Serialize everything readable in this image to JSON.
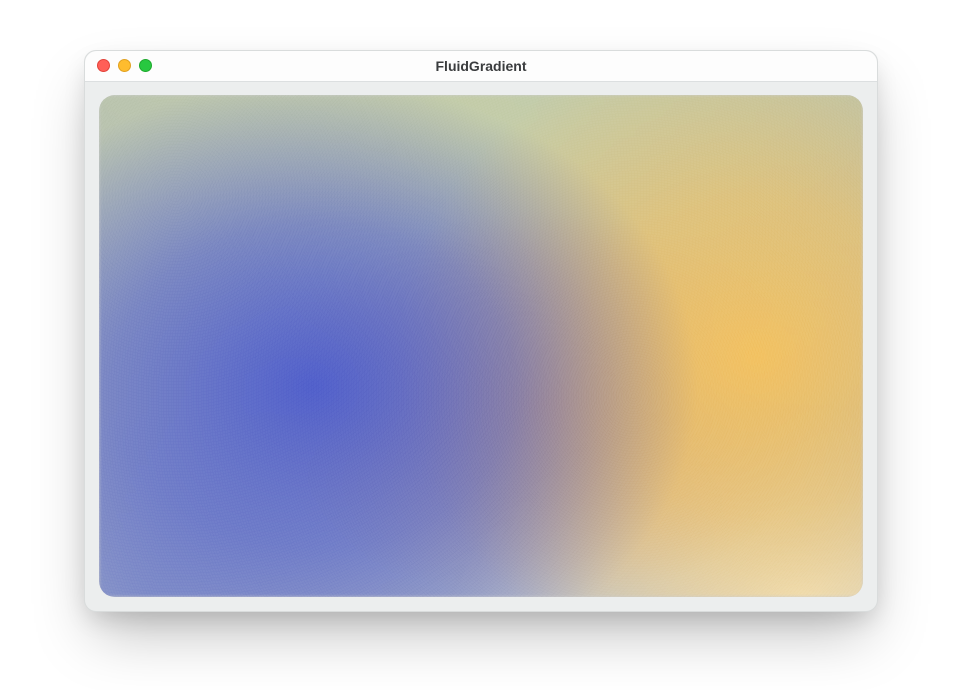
{
  "window": {
    "title": "FluidGradient"
  },
  "traffic_lights": {
    "close_name": "close",
    "minimize_name": "minimize",
    "zoom_name": "zoom"
  },
  "gradient": {
    "kind": "fluid-radial-blend",
    "description": "Soft multi-blob gradient: cool blue lower-left, warm yellow-orange right side, muted olive upper band",
    "corner_radius_px": 16,
    "blobs": [
      {
        "role": "cool",
        "center_pct": [
          28,
          58
        ],
        "color": "#4e5ece"
      },
      {
        "role": "warm",
        "center_pct": [
          86,
          52
        ],
        "color": "#f6c460"
      },
      {
        "role": "ember",
        "center_pct": [
          58,
          62
        ],
        "color": "#d68858"
      },
      {
        "role": "olive",
        "center_pct": [
          50,
          6
        ],
        "color": "#c8d0aa"
      },
      {
        "role": "cream",
        "center_pct": [
          92,
          100
        ],
        "color": "#f5eccf"
      },
      {
        "role": "slate",
        "center_pct": [
          6,
          100
        ],
        "color": "#8795c9"
      }
    ],
    "base_gradient": {
      "from": "#bcc6b0",
      "to": "#aeb4c5"
    }
  }
}
